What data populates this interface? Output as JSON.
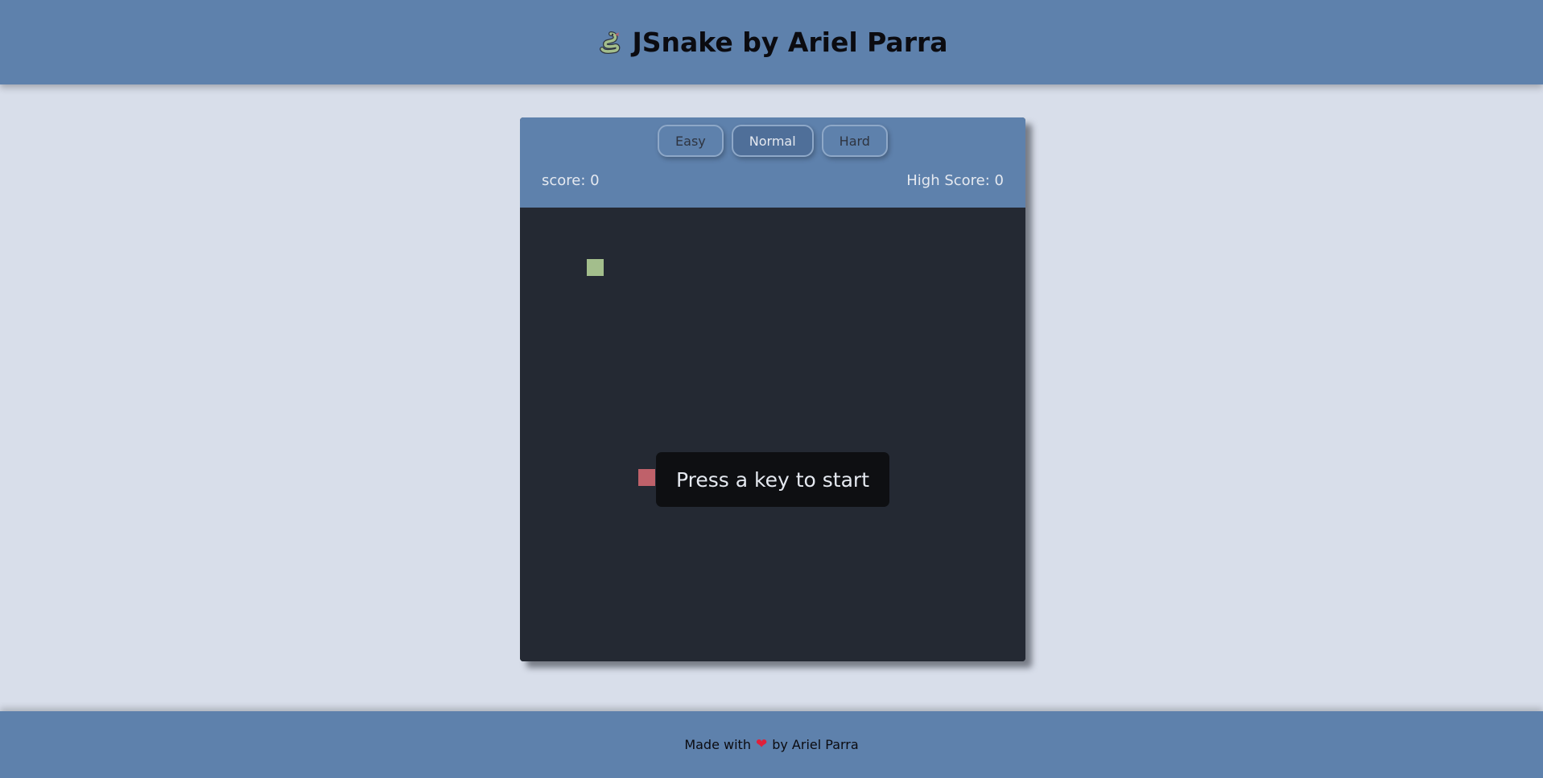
{
  "header": {
    "icon": "snake-icon",
    "title": "JSnake by Ariel Parra"
  },
  "game": {
    "difficulty": {
      "options": [
        "Easy",
        "Normal",
        "Hard"
      ],
      "selected": "Normal"
    },
    "score_text": "score: 0",
    "high_score_text": "High Score: 0",
    "start_message": "Press a key to start",
    "colors": {
      "snake": "#a3be8c",
      "food": "#bf616a",
      "board": "#242933",
      "accent": "#5e81ac"
    }
  },
  "footer": {
    "made_with": "Made with",
    "heart_icon": "heart-icon",
    "by": "by Ariel Parra"
  }
}
